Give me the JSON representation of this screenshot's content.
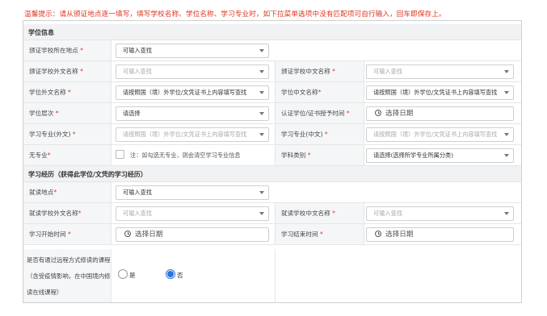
{
  "tip": "温馨提示：请从颁证地点逐一填写，填写学校名称、学位名称、学习专业时，如下拉菜单选项中没有匹配项可自行输入，回车即保存上。",
  "section_degree": "学位信息",
  "section_study": "学习经历（获得此学位/文凭的学习经历）",
  "required_mark": "*",
  "rows": {
    "r1": {
      "label": "颁证学校所在地点",
      "value": "可输入查找"
    },
    "r2": {
      "label_l": "颁证学校外文名称",
      "value_l": "可输入查找",
      "label_r": "颁证学校中文名称",
      "value_r": "可输入查找"
    },
    "r3": {
      "label_l": "学位外文名称",
      "value_l": "请按照国（境）外学位/文凭证书上内容填写查找",
      "label_r": "学位中文名称",
      "value_r": "请按照国（境）外学位/文凭证书上内容填写查找"
    },
    "r4": {
      "label_l": "学位层次",
      "value_l": "请选择",
      "label_r": "认证学位/证书授予时间",
      "value_r": "选择日期"
    },
    "r5": {
      "label_l": "学习专业(外文)",
      "value_l": "请按照国（境）外学位/文凭证书上内容填写查找",
      "label_r": "学习专业(中文)",
      "value_r": "请按照国（境）外学位/文凭证书上内容填写查找"
    },
    "r6": {
      "label_l": "无专业",
      "note": "注：如勾选无专业，则会清空学习专业信息",
      "label_r": "学科类别",
      "value_r": "请选择(选择所学专业所属分类)"
    },
    "r7": {
      "label": "就读地点",
      "value": "可输入查找"
    },
    "r8": {
      "label_l": "就读学校外文名称",
      "value_l": "可输入查找",
      "label_r": "就读学校中文名称",
      "value_r": "可输入查找"
    },
    "r9": {
      "label_l": "学习开始时间",
      "value_l": "选择日期",
      "label_r": "学习结束时间",
      "value_r": "选择日期"
    }
  },
  "distance": {
    "line1": "是否有通过远程方式修读的课程",
    "line2": "（含受疫情影响，在中国境内修",
    "line3": "读在线课程）",
    "yes": "是",
    "no": "否",
    "selected": "否"
  }
}
